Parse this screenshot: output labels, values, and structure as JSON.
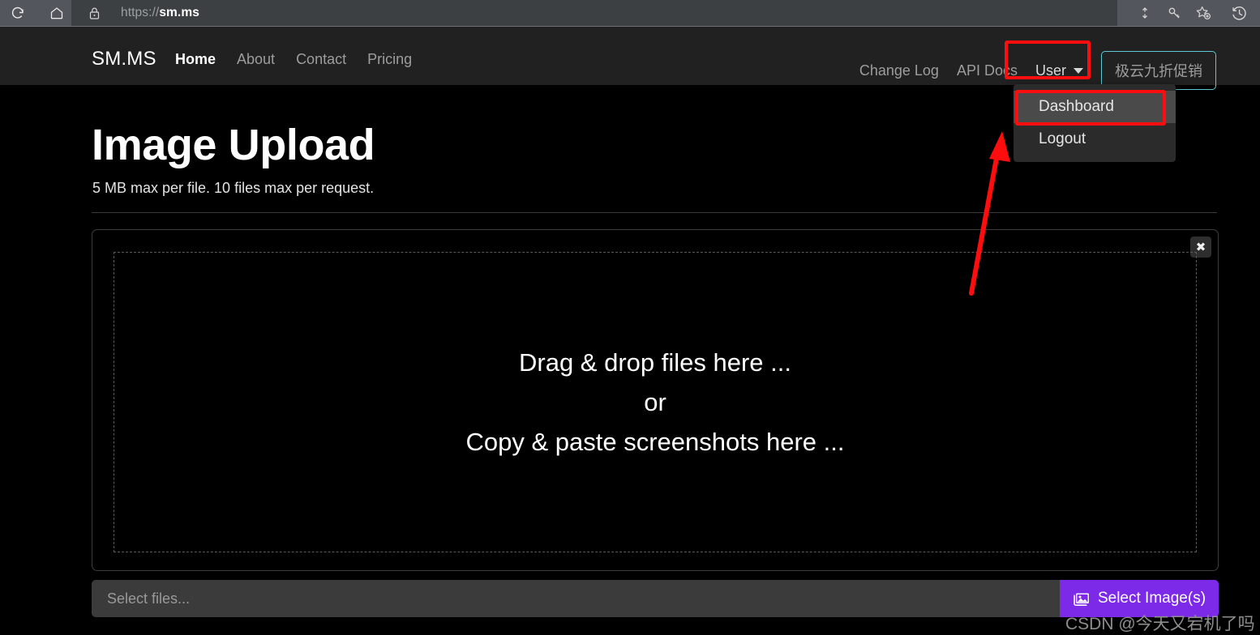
{
  "browser": {
    "url_prefix": "https://",
    "url_domain": "sm.ms",
    "reload_icon": "reload-icon",
    "home_icon": "home-icon",
    "lock_icon": "lock-icon",
    "right_icons": [
      "split-screen-icon",
      "key-icon",
      "add-favorite-icon",
      "history-icon"
    ]
  },
  "navbar": {
    "brand": "SM.MS",
    "left_items": [
      {
        "label": "Home",
        "active": true
      },
      {
        "label": "About",
        "active": false
      },
      {
        "label": "Contact",
        "active": false
      },
      {
        "label": "Pricing",
        "active": false
      }
    ],
    "right_items": [
      {
        "label": "Change Log"
      },
      {
        "label": "API Docs"
      }
    ],
    "user_label": "User",
    "promo_label": "极云九折促销"
  },
  "dropdown": {
    "items": [
      {
        "label": "Dashboard",
        "highlighted": true
      },
      {
        "label": "Logout",
        "highlighted": false
      }
    ]
  },
  "page": {
    "title": "Image Upload",
    "subtitle": "5 MB max per file. 10 files max per request."
  },
  "upload": {
    "close_label": "✖",
    "dropzone_lines": [
      "Drag & drop files here ...",
      "or",
      "Copy & paste screenshots here ..."
    ],
    "file_placeholder": "Select files...",
    "select_button_label": "Select Image(s)"
  },
  "watermark": "CSDN @今天又宕机了吗",
  "colors": {
    "browser_chrome": "#53565c",
    "url_field": "#3d4043",
    "navbar": "#212121",
    "page_background": "#000000",
    "promo_border": "#5fc9d6",
    "select_button": "#7d2ae8",
    "annotation_red": "#fd0d0d",
    "dropdown_bg": "#2b2b2b",
    "dropdown_highlight": "#4a4a4a"
  }
}
